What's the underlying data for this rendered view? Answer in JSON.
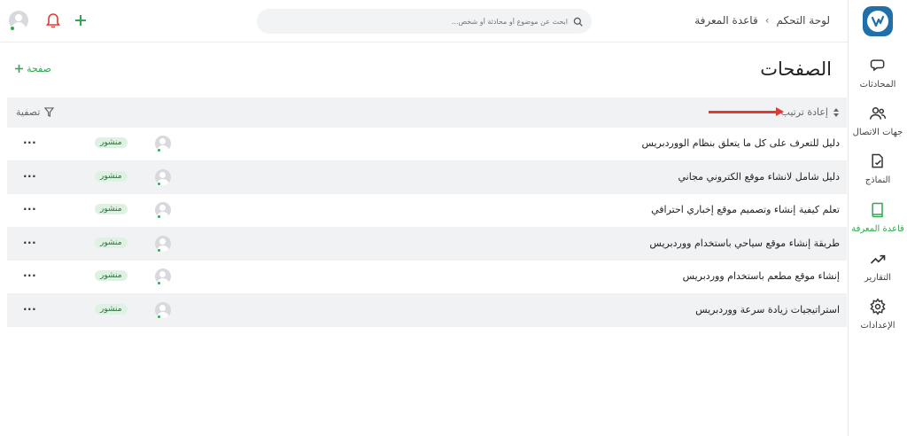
{
  "header": {
    "breadcrumb": [
      "لوحة التحكم",
      "قاعدة المعرفة"
    ],
    "search_placeholder": "ابحث عن موضوع أو محادثة أو شخص..."
  },
  "sidebar": {
    "items": [
      {
        "label": "المحادثات",
        "icon": "chat-icon"
      },
      {
        "label": "جهات الاتصال",
        "icon": "contacts-icon"
      },
      {
        "label": "النماذج",
        "icon": "form-icon"
      },
      {
        "label": "قاعدة المعرفة",
        "icon": "book-icon",
        "active": true
      },
      {
        "label": "التقارير",
        "icon": "chart-icon"
      },
      {
        "label": "الإعدادات",
        "icon": "gear-icon"
      }
    ]
  },
  "page": {
    "title": "الصفحات",
    "add_label": "صفحة"
  },
  "table": {
    "reorder_label": "إعادة ترتيب",
    "filter_label": "تصفية",
    "rows": [
      {
        "title": "دليل للتعرف على كل ما يتعلق بنظام الووردبريس",
        "status": "منشور"
      },
      {
        "title": "دليل شامل لانشاء موقع الكتروني مجاني",
        "status": "منشور"
      },
      {
        "title": "تعلم كيفية إنشاء وتصميم موقع إخباري احترافي",
        "status": "منشور"
      },
      {
        "title": "طريقة إنشاء موقع سياحي باستخدام ووردبريس",
        "status": "منشور"
      },
      {
        "title": "إنشاء موقع مطعم باستخدام ووردبريس",
        "status": "منشور"
      },
      {
        "title": "استراتيجيات زيادة سرعة ووردبريس",
        "status": "منشور"
      }
    ],
    "more_label": "···"
  },
  "colors": {
    "accent": "#2fa84f",
    "brand": "#1f6fa8",
    "alert": "#e03a32"
  }
}
